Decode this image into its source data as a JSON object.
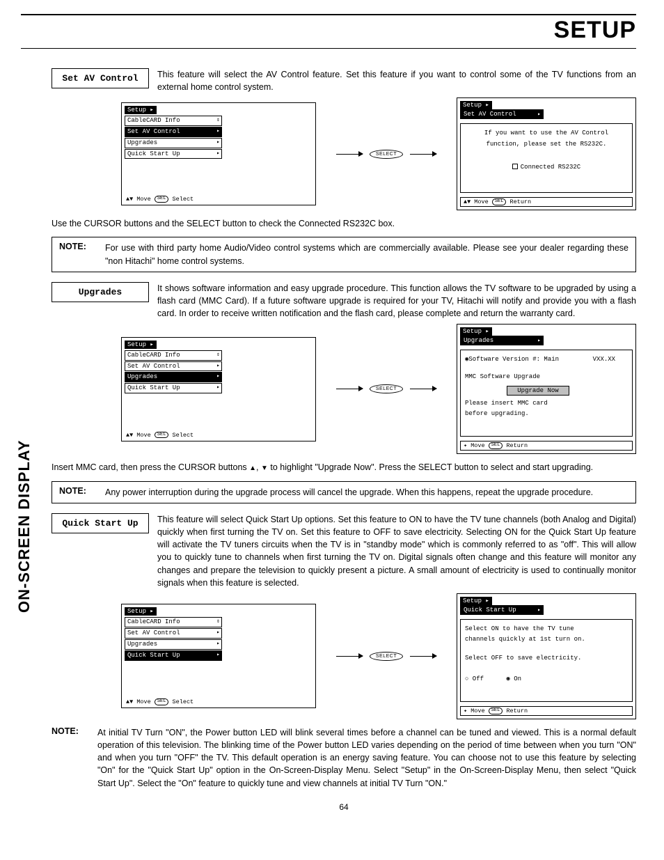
{
  "page": {
    "title": "SETUP",
    "number": "64",
    "sidebar_label": "ON-SCREEN DISPLAY"
  },
  "sections": {
    "avcontrol": {
      "label": "Set AV Control",
      "text": "This feature will select the AV Control feature. Set this feature if you want to control some of the TV functions from an external home control system.",
      "instr": "Use the CURSOR buttons and the SELECT button to check the Connected RS232C box.",
      "note_label": "NOTE:",
      "note_text": "For use with third party home Audio/Video control systems which are commercially available. Please see your dealer regarding these \"non Hitachi\" home control systems."
    },
    "upgrades": {
      "label": "Upgrades",
      "text": "It shows software information and easy upgrade procedure. This function allows the TV software to be upgraded by using a flash card (MMC Card). If a future software upgrade is required for your TV, Hitachi will notify and provide you with a flash card. In order to receive written notification and the flash card, please complete and return the warranty card.",
      "instr1": "Insert MMC card, then press the CURSOR buttons ",
      "instr2": " to highlight \"Upgrade Now\". Press the SELECT button to select and start upgrading.",
      "note_label": "NOTE:",
      "note_text": "Any power interruption during the upgrade process will cancel the upgrade. When this happens, repeat the upgrade procedure."
    },
    "quickstart": {
      "label": "Quick Start Up",
      "text": "This feature will select Quick Start Up options. Set this feature to ON to have the TV tune channels (both Analog and Digital) quickly when first turning the TV on. Set this feature to OFF to save electricity. Selecting ON for the Quick Start Up feature will activate the TV tuners circuits when the TV is in \"standby mode\" which is commonly referred to as \"off\". This will allow you to quickly tune to channels when first turning the TV on. Digital signals often change and this feature will monitor any changes and prepare the television to quickly present a picture. A small amount of electricity is used to continually monitor signals when this feature is selected.",
      "note_label": "NOTE:",
      "note_text": "At initial TV Turn \"ON\", the Power button LED will blink several times before a channel can be tuned and viewed. This is a normal default operation of this television. The blinking time of the Power button LED varies depending on the period of time between when you turn \"ON\" and when you turn \"OFF\" the TV. This default operation is an energy saving feature. You can choose not to use this feature by selecting \"On\" for the \"Quick Start Up\" option in the On-Screen-Display Menu. Select \"Setup\" in the On-Screen-Display Menu, then select \"Quick Start Up\". Select the \"On\" feature to quickly tune and view channels at initial TV Turn \"ON.\""
    }
  },
  "menu": {
    "setup_tab": "Setup",
    "items": [
      "CableCARD Info",
      "Set AV Control",
      "Upgrades",
      "Quick Start Up"
    ],
    "footer_move": "Move",
    "footer_select": "Select",
    "footer_return": "Return",
    "sel_label": "SEL",
    "select_btn": "SELECT"
  },
  "detail_av": {
    "subtab": "Set AV Control",
    "line1": "If you want to use the AV Control",
    "line2": "function, please set the RS232C.",
    "check": "Connected RS232C"
  },
  "detail_upg": {
    "subtab": "Upgrades",
    "sw_label": "Software Version #: Main",
    "sw_val": "VXX.XX",
    "mmc": "MMC Software Upgrade",
    "btn": "Upgrade Now",
    "msg1": "Please insert MMC card",
    "msg2": "before upgrading."
  },
  "detail_qs": {
    "subtab": "Quick Start Up",
    "line1": "Select ON to have the TV tune",
    "line2": "channels quickly at 1st turn on.",
    "line3": "Select OFF to save electricity.",
    "off": "Off",
    "on": "On"
  }
}
